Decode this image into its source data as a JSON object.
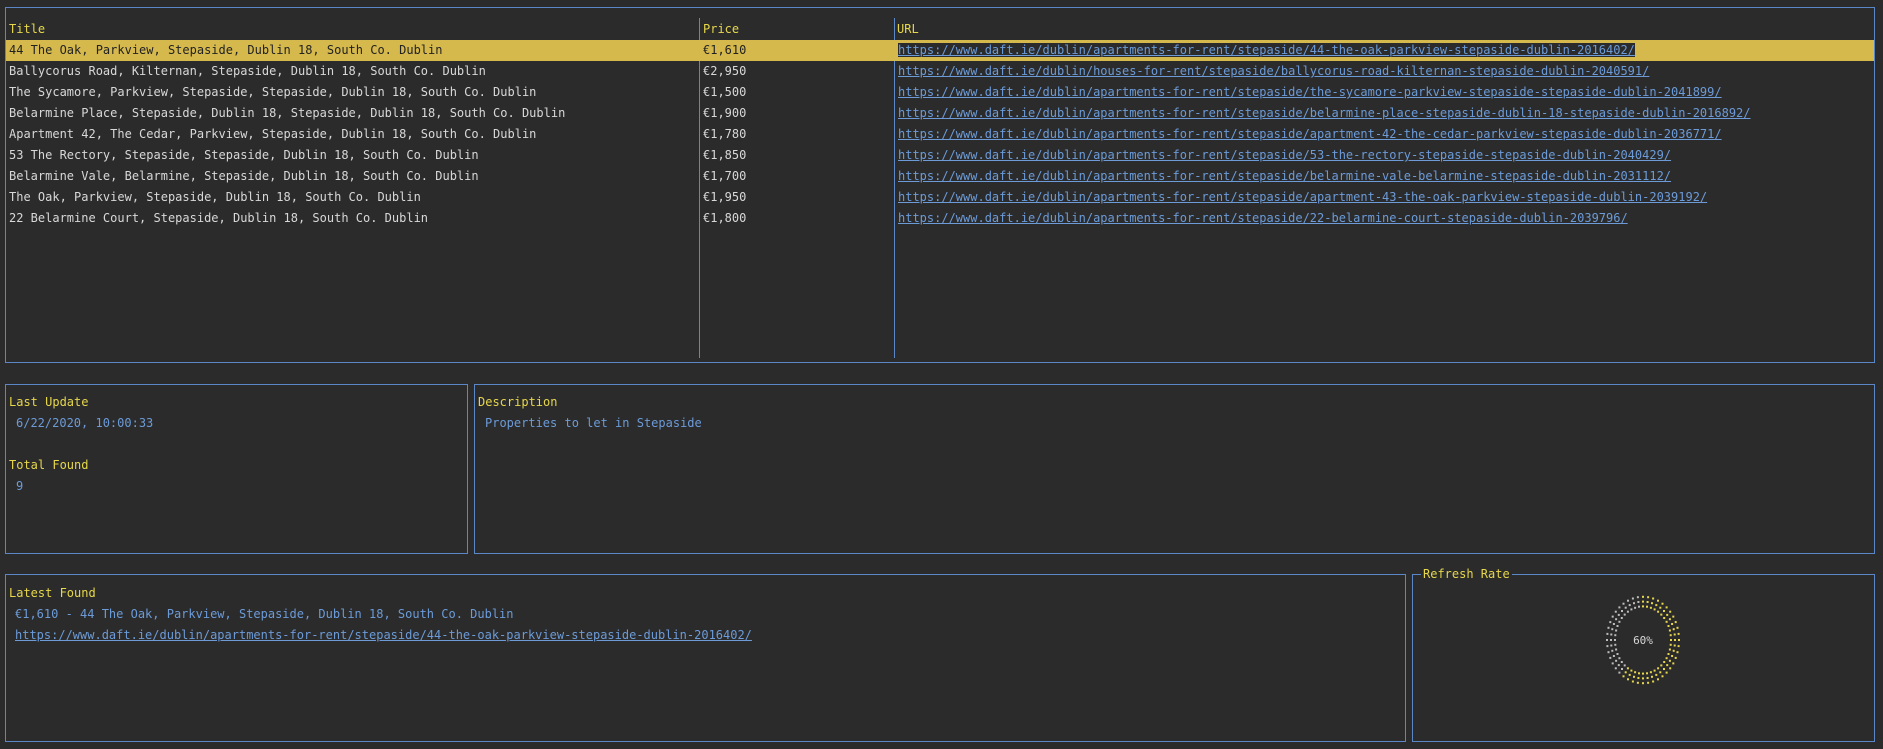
{
  "table": {
    "headers": {
      "title": "Title",
      "price": "Price",
      "url": "URL"
    },
    "rows": [
      {
        "title": "44 The Oak, Parkview, Stepaside, Dublin 18, South Co. Dublin",
        "price": "€1,610",
        "url": "https://www.daft.ie/dublin/apartments-for-rent/stepaside/44-the-oak-parkview-stepaside-dublin-2016402/",
        "selected": true
      },
      {
        "title": "Ballycorus Road, Kilternan, Stepaside, Dublin 18, South Co. Dublin",
        "price": "€2,950",
        "url": "https://www.daft.ie/dublin/houses-for-rent/stepaside/ballycorus-road-kilternan-stepaside-dublin-2040591/"
      },
      {
        "title": "The Sycamore, Parkview, Stepaside, Stepaside, Dublin 18, South Co. Dublin",
        "price": "€1,500",
        "url": "https://www.daft.ie/dublin/apartments-for-rent/stepaside/the-sycamore-parkview-stepaside-stepaside-dublin-2041899/"
      },
      {
        "title": "Belarmine Place, Stepaside, Dublin 18, Stepaside, Dublin 18, South Co. Dublin",
        "price": "€1,900",
        "url": "https://www.daft.ie/dublin/apartments-for-rent/stepaside/belarmine-place-stepaside-dublin-18-stepaside-dublin-2016892/"
      },
      {
        "title": "Apartment 42, The Cedar, Parkview, Stepaside, Dublin 18, South Co. Dublin",
        "price": "€1,780",
        "url": "https://www.daft.ie/dublin/apartments-for-rent/stepaside/apartment-42-the-cedar-parkview-stepaside-dublin-2036771/"
      },
      {
        "title": "53 The Rectory, Stepaside, Stepaside, Dublin 18, South Co. Dublin",
        "price": "€1,850",
        "url": "https://www.daft.ie/dublin/apartments-for-rent/stepaside/53-the-rectory-stepaside-stepaside-dublin-2040429/"
      },
      {
        "title": "Belarmine Vale, Belarmine, Stepaside, Dublin 18, South Co. Dublin",
        "price": "€1,700",
        "url": "https://www.daft.ie/dublin/apartments-for-rent/stepaside/belarmine-vale-belarmine-stepaside-dublin-2031112/"
      },
      {
        "title": "The Oak, Parkview, Stepaside, Dublin 18, South Co. Dublin",
        "price": "€1,950",
        "url": "https://www.daft.ie/dublin/apartments-for-rent/stepaside/apartment-43-the-oak-parkview-stepaside-dublin-2039192/"
      },
      {
        "title": "22 Belarmine Court, Stepaside, Dublin 18, South Co. Dublin",
        "price": "€1,800",
        "url": "https://www.daft.ie/dublin/apartments-for-rent/stepaside/22-belarmine-court-stepaside-dublin-2039796/"
      }
    ]
  },
  "info": {
    "last_update_label": "Last Update",
    "last_update_value": "6/22/2020, 10:00:33",
    "total_found_label": "Total Found",
    "total_found_value": "9"
  },
  "description": {
    "label": "Description",
    "value": "Properties to let in Stepaside"
  },
  "latest": {
    "label": "Latest Found",
    "line": "€1,610 - 44 The Oak, Parkview, Stepaside, Dublin 18, South Co. Dublin",
    "url": "https://www.daft.ie/dublin/apartments-for-rent/stepaside/44-the-oak-parkview-stepaside-dublin-2016402/"
  },
  "refresh": {
    "title": "Refresh Rate",
    "percent_label": "60%",
    "fraction": 0.6
  },
  "colors": {
    "border": "#5b87c6",
    "accent": "#e6d74b",
    "selected_row": "#d6b94d",
    "link": "#6c9bd8"
  }
}
